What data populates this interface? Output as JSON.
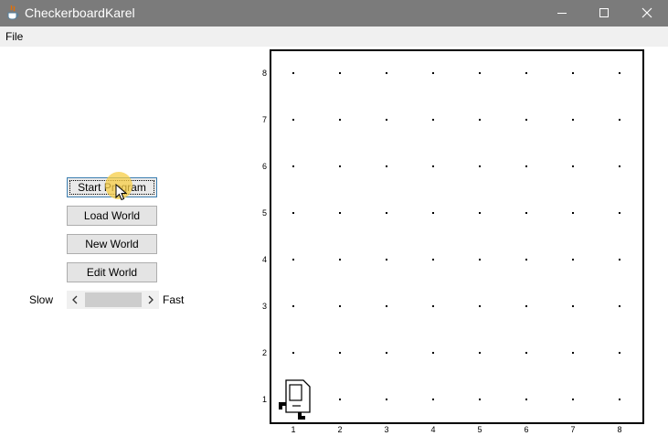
{
  "window": {
    "title": "CheckerboardKarel",
    "app_icon": "java-coffee-cup-icon",
    "controls": [
      "minimize-icon",
      "maximize-icon",
      "close-icon"
    ]
  },
  "menu": {
    "items": [
      "File"
    ]
  },
  "controls": {
    "start_label": "Start Program",
    "load_label": "Load World",
    "new_label": "New World",
    "edit_label": "Edit World",
    "speed": {
      "slow_label": "Slow",
      "fast_label": "Fast"
    }
  },
  "world": {
    "streets": [
      "1",
      "2",
      "3",
      "4",
      "5",
      "6",
      "7",
      "8"
    ],
    "avenues": [
      "1",
      "2",
      "3",
      "4",
      "5",
      "6",
      "7",
      "8"
    ],
    "karel": {
      "avenue": 1,
      "street": 1,
      "facing": "east"
    }
  },
  "colors": {
    "titlebar": "#7b7b7b",
    "cursor_highlight": "#f7ce46",
    "grid_border": "#000000"
  }
}
